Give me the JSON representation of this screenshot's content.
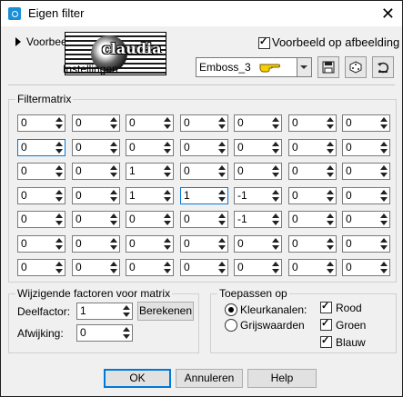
{
  "window": {
    "title": "Eigen filter"
  },
  "top": {
    "preview_label": "Voorbeeld",
    "settings_label": "Instellingen",
    "logo_text": "claudia",
    "preview_on_image_label": "Voorbeeld op afbeelding",
    "preset_value": "Emboss_3"
  },
  "matrix": {
    "title": "Filtermatrix",
    "rows": [
      [
        "0",
        "0",
        "0",
        "0",
        "0",
        "0",
        "0"
      ],
      [
        "0",
        "0",
        "0",
        "0",
        "0",
        "0",
        "0"
      ],
      [
        "0",
        "0",
        "1",
        "0",
        "0",
        "0",
        "0"
      ],
      [
        "0",
        "0",
        "1",
        "1",
        "-1",
        "0",
        "0"
      ],
      [
        "0",
        "0",
        "0",
        "0",
        "-1",
        "0",
        "0"
      ],
      [
        "0",
        "0",
        "0",
        "0",
        "0",
        "0",
        "0"
      ],
      [
        "0",
        "0",
        "0",
        "0",
        "0",
        "0",
        "0"
      ]
    ]
  },
  "factors": {
    "title": "Wijzigende factoren voor matrix",
    "divisor_label": "Deelfactor:",
    "divisor_value": "1",
    "calculate_label": "Berekenen",
    "bias_label": "Afwijking:",
    "bias_value": "0"
  },
  "apply": {
    "title": "Toepassen op",
    "color_channels_label": "Kleurkanalen:",
    "grayscale_label": "Grijswaarden",
    "red_label": "Rood",
    "green_label": "Groen",
    "blue_label": "Blauw"
  },
  "buttons": {
    "ok": "OK",
    "cancel": "Annuleren",
    "help": "Help"
  }
}
